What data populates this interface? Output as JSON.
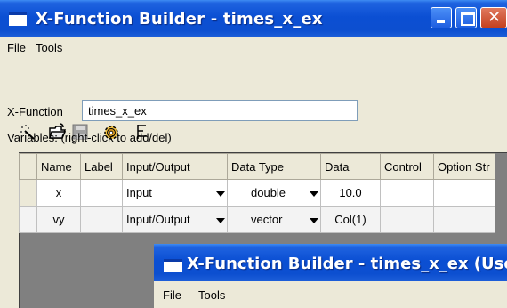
{
  "window": {
    "title": "X-Function Builder - times_x_ex",
    "menu": [
      "File",
      "Tools"
    ]
  },
  "toolbar": {
    "icons": [
      "wand-icon",
      "open-folder-icon",
      "save-icon",
      "compile-gear-icon",
      "tree-icon"
    ]
  },
  "form": {
    "xfunction_label": "X-Function",
    "xfunction_value": "times_x_ex",
    "variables_label": "Variables: (right-click to add/del)"
  },
  "table": {
    "headers": [
      "Name",
      "Label",
      "Input/Output",
      "Data Type",
      "Data",
      "Control",
      "Option Str"
    ],
    "rows": [
      {
        "name": "x",
        "label": "",
        "io": "Input",
        "type": "double",
        "data": "10.0",
        "control": "",
        "option": ""
      },
      {
        "name": "vy",
        "label": "",
        "io": "Input/Output",
        "type": "vector",
        "data": "Col(1)",
        "control": "",
        "option": ""
      }
    ]
  },
  "window2": {
    "title": "X-Function Builder - times_x_ex (User)*",
    "menu": [
      "File",
      "Tools"
    ]
  },
  "colors": {
    "titlebar": "#0b4fd3",
    "chrome": "#ece9d8",
    "grid_background": "#808080"
  }
}
